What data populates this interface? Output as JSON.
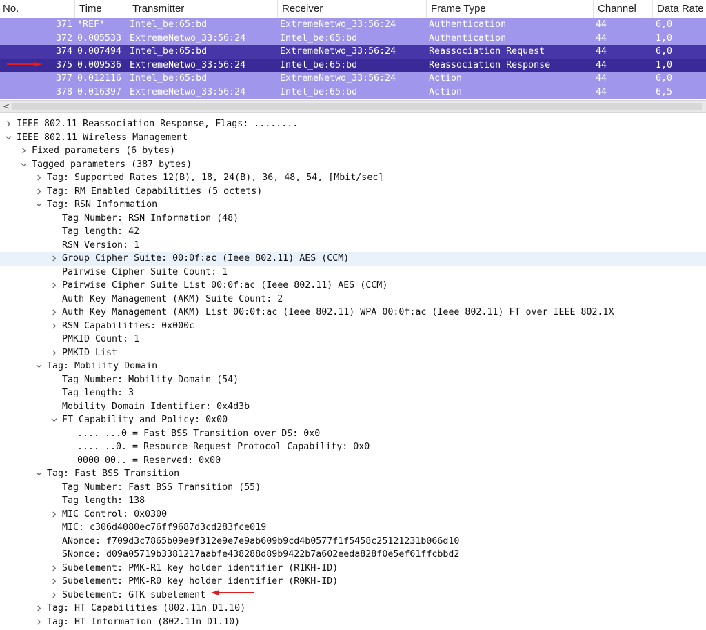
{
  "packet_list": {
    "columns": [
      "No.",
      "Time",
      "Transmitter",
      "Receiver",
      "Frame Type",
      "Channel",
      "Data Rate"
    ],
    "rows": [
      {
        "no": "371",
        "time": "*REF*",
        "tx": "Intel_be:65:bd",
        "rx": "ExtremeNetwo_33:56:24",
        "type": "Authentication",
        "ch": "44",
        "rate": "6,0"
      },
      {
        "no": "372",
        "time": "0.005533",
        "tx": "ExtremeNetwo_33:56:24",
        "rx": "Intel_be:65:bd",
        "type": "Authentication",
        "ch": "44",
        "rate": "1,0"
      },
      {
        "no": "374",
        "time": "0.007494",
        "tx": "Intel_be:65:bd",
        "rx": "ExtremeNetwo_33:56:24",
        "type": "Reassociation Request",
        "ch": "44",
        "rate": "6,0"
      },
      {
        "no": "375",
        "time": "0.009536",
        "tx": "ExtremeNetwo_33:56:24",
        "rx": "Intel_be:65:bd",
        "type": "Reassociation Response",
        "ch": "44",
        "rate": "1,0"
      },
      {
        "no": "377",
        "time": "0.012116",
        "tx": "Intel_be:65:bd",
        "rx": "ExtremeNetwo_33:56:24",
        "type": "Action",
        "ch": "44",
        "rate": "6,0"
      },
      {
        "no": "378",
        "time": "0.016397",
        "tx": "ExtremeNetwo_33:56:24",
        "rx": "Intel_be:65:bd",
        "type": "Action",
        "ch": "44",
        "rate": "6,5"
      }
    ]
  },
  "details": [
    {
      "t": "IEEE 802.11 Reassociation Response, Flags: ........",
      "lvl": 0,
      "tog": "collapsed"
    },
    {
      "t": "IEEE 802.11 Wireless Management",
      "lvl": 0,
      "tog": "expanded"
    },
    {
      "t": "Fixed parameters (6 bytes)",
      "lvl": 1,
      "tog": "collapsed"
    },
    {
      "t": "Tagged parameters (387 bytes)",
      "lvl": 1,
      "tog": "expanded"
    },
    {
      "t": "Tag: Supported Rates 12(B), 18, 24(B), 36, 48, 54, [Mbit/sec]",
      "lvl": 2,
      "tog": "collapsed"
    },
    {
      "t": "Tag: RM Enabled Capabilities (5 octets)",
      "lvl": 2,
      "tog": "collapsed"
    },
    {
      "t": "Tag: RSN Information",
      "lvl": 2,
      "tog": "expanded"
    },
    {
      "t": "Tag Number: RSN Information (48)",
      "lvl": 3,
      "tog": "none"
    },
    {
      "t": "Tag length: 42",
      "lvl": 3,
      "tog": "none"
    },
    {
      "t": "RSN Version: 1",
      "lvl": 3,
      "tog": "none"
    },
    {
      "t": "Group Cipher Suite: 00:0f:ac (Ieee 802.11) AES (CCM)",
      "lvl": 3,
      "tog": "collapsed",
      "hl": true
    },
    {
      "t": "Pairwise Cipher Suite Count: 1",
      "lvl": 3,
      "tog": "none"
    },
    {
      "t": "Pairwise Cipher Suite List 00:0f:ac (Ieee 802.11) AES (CCM)",
      "lvl": 3,
      "tog": "collapsed"
    },
    {
      "t": "Auth Key Management (AKM) Suite Count: 2",
      "lvl": 3,
      "tog": "none"
    },
    {
      "t": "Auth Key Management (AKM) List 00:0f:ac (Ieee 802.11) WPA 00:0f:ac (Ieee 802.11) FT over IEEE 802.1X",
      "lvl": 3,
      "tog": "collapsed"
    },
    {
      "t": "RSN Capabilities: 0x000c",
      "lvl": 3,
      "tog": "collapsed"
    },
    {
      "t": "PMKID Count: 1",
      "lvl": 3,
      "tog": "none"
    },
    {
      "t": "PMKID List",
      "lvl": 3,
      "tog": "collapsed"
    },
    {
      "t": "Tag: Mobility Domain",
      "lvl": 2,
      "tog": "expanded"
    },
    {
      "t": "Tag Number: Mobility Domain (54)",
      "lvl": 3,
      "tog": "none"
    },
    {
      "t": "Tag length: 3",
      "lvl": 3,
      "tog": "none"
    },
    {
      "t": "Mobility Domain Identifier: 0x4d3b",
      "lvl": 3,
      "tog": "none"
    },
    {
      "t": "FT Capability and Policy: 0x00",
      "lvl": 3,
      "tog": "expanded"
    },
    {
      "t": ".... ...0 = Fast BSS Transition over DS: 0x0",
      "lvl": 4,
      "tog": "none"
    },
    {
      "t": ".... ..0. = Resource Request Protocol Capability: 0x0",
      "lvl": 4,
      "tog": "none"
    },
    {
      "t": "0000 00.. = Reserved: 0x00",
      "lvl": 4,
      "tog": "none"
    },
    {
      "t": "Tag: Fast BSS Transition",
      "lvl": 2,
      "tog": "expanded"
    },
    {
      "t": "Tag Number: Fast BSS Transition (55)",
      "lvl": 3,
      "tog": "none"
    },
    {
      "t": "Tag length: 138",
      "lvl": 3,
      "tog": "none"
    },
    {
      "t": "MIC Control: 0x0300",
      "lvl": 3,
      "tog": "collapsed"
    },
    {
      "t": "MIC: c306d4080ec76ff9687d3cd283fce019",
      "lvl": 3,
      "tog": "none"
    },
    {
      "t": "ANonce: f709d3c7865b09e9f312e9e7e9ab609b9cd4b0577f1f5458c25121231b066d10",
      "lvl": 3,
      "tog": "none"
    },
    {
      "t": "SNonce: d09a05719b3381217aabfe438288d89b9422b7a602eeda828f0e5ef61ffcbbd2",
      "lvl": 3,
      "tog": "none"
    },
    {
      "t": "Subelement: PMK-R1 key holder identifier (R1KH-ID)",
      "lvl": 3,
      "tog": "collapsed"
    },
    {
      "t": "Subelement: PMK-R0 key holder identifier (R0KH-ID)",
      "lvl": 3,
      "tog": "collapsed"
    },
    {
      "t": "Subelement: GTK subelement",
      "lvl": 3,
      "tog": "collapsed"
    },
    {
      "t": "Tag: HT Capabilities (802.11n D1.10)",
      "lvl": 2,
      "tog": "collapsed"
    },
    {
      "t": "Tag: HT Information (802.11n D1.10)",
      "lvl": 2,
      "tog": "collapsed"
    }
  ],
  "colors": {
    "row": "#a097ec",
    "selected_row": "#3a2a98",
    "highlight": "#e9f1fb",
    "annotation_arrow": "#e21b1b"
  }
}
